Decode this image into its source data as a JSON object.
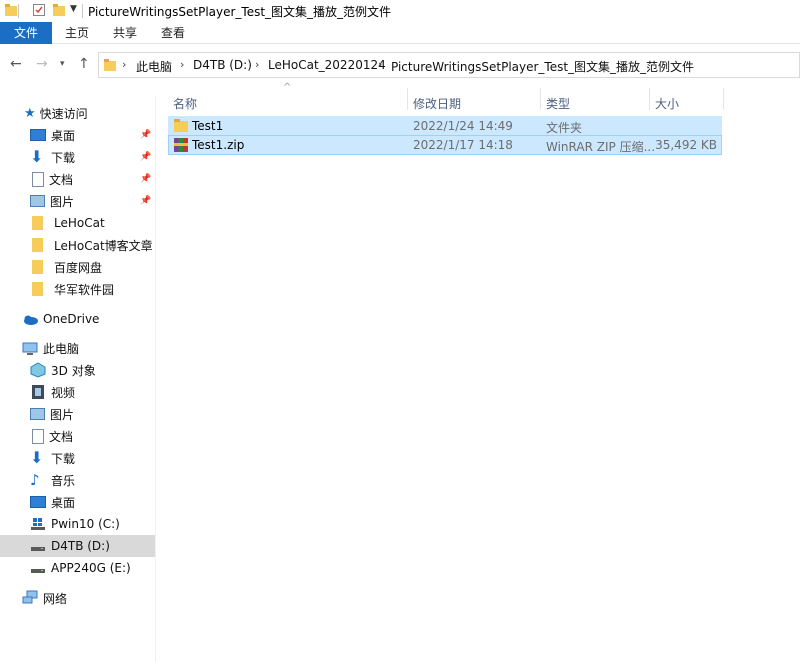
{
  "window": {
    "title": "PictureWritingsSetPlayer_Test_图文集_播放_范例文件"
  },
  "ribbon": {
    "tabs": [
      "文件",
      "主页",
      "共享",
      "查看"
    ]
  },
  "address": {
    "crumbs": [
      "此电脑",
      "D4TB (D:)",
      "LeHoCat_20220124",
      "PictureWritingsSetPlayer_Test_图文集_播放_范例文件"
    ]
  },
  "sidebar": {
    "quick_access": "快速访问",
    "quick_items": [
      "桌面",
      "下载",
      "文档",
      "图片",
      "LeHoCat",
      "LeHoCat博客文章",
      "百度网盘",
      "华军软件园"
    ],
    "onedrive": "OneDrive",
    "this_pc": "此电脑",
    "pc_items": [
      "3D 对象",
      "视频",
      "图片",
      "文档",
      "下载",
      "音乐",
      "桌面",
      "Pwin10 (C:)",
      "D4TB (D:)",
      "APP240G (E:)"
    ],
    "network": "网络"
  },
  "columns": {
    "name": "名称",
    "date": "修改日期",
    "type": "类型",
    "size": "大小"
  },
  "files": [
    {
      "name": "Test1",
      "date": "2022/1/24 14:49",
      "type": "文件夹",
      "size": "",
      "icon": "folder-icon"
    },
    {
      "name": "Test1.zip",
      "date": "2022/1/17 14:18",
      "type": "WinRAR ZIP 压缩...",
      "size": "35,492 KB",
      "icon": "winrar-archive-icon"
    }
  ],
  "colors": {
    "accent": "#1a6fc4",
    "selection": "#cce8ff",
    "selection_border": "#99d1ff",
    "sidebar_selected": "#d9d9d9"
  }
}
